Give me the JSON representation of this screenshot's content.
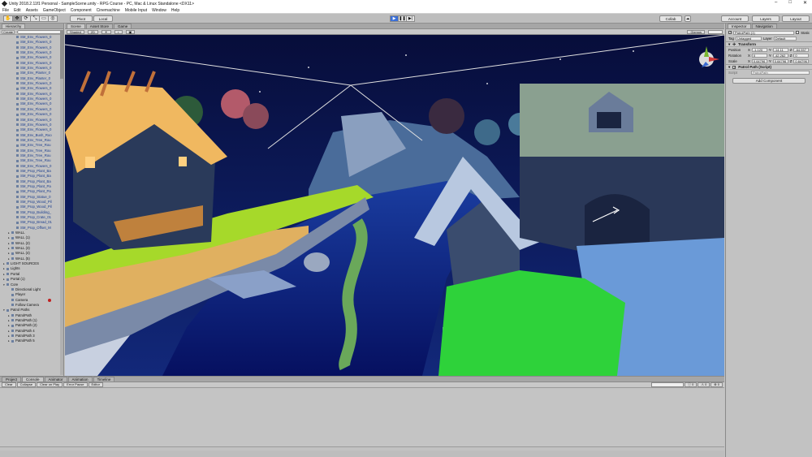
{
  "window": {
    "title": "Unity 2018.2.11f1 Personal - SampleScene.unity - RPG Course - PC, Mac & Linux Standalone <DX11>"
  },
  "menu": [
    "File",
    "Edit",
    "Assets",
    "GameObject",
    "Component",
    "Cinemachine",
    "Mobile Input",
    "Window",
    "Help"
  ],
  "toolbar": {
    "pivot": "Pivot",
    "local": "Local",
    "collab": "Collab",
    "account": "Account",
    "layers": "Layers",
    "layout": "Layout"
  },
  "hierarchy": {
    "tab": "Hierarchy",
    "create": "Create",
    "rows": [
      {
        "label": "SM_Env_Flowers_0",
        "indent": 2,
        "prefab": true
      },
      {
        "label": "SM_Env_Flowers_0",
        "indent": 2,
        "prefab": true
      },
      {
        "label": "SM_Env_Flowers_0",
        "indent": 2,
        "prefab": true
      },
      {
        "label": "SM_Env_Flowers_0",
        "indent": 2,
        "prefab": true
      },
      {
        "label": "SM_Env_Flowers_0",
        "indent": 2,
        "prefab": true
      },
      {
        "label": "SM_Env_Flowers_0",
        "indent": 2,
        "prefab": true
      },
      {
        "label": "SM_Env_Flowers_0",
        "indent": 2,
        "prefab": true
      },
      {
        "label": "SM_Env_Planter_0",
        "indent": 2,
        "prefab": true
      },
      {
        "label": "SM_Env_Planter_0",
        "indent": 2,
        "prefab": true
      },
      {
        "label": "SM_Env_Flowers_0",
        "indent": 2,
        "prefab": true
      },
      {
        "label": "SM_Env_Flowers_0",
        "indent": 2,
        "prefab": true
      },
      {
        "label": "SM_Env_Flowers_0",
        "indent": 2,
        "prefab": true
      },
      {
        "label": "SM_Env_Flowers_0",
        "indent": 2,
        "prefab": true
      },
      {
        "label": "SM_Env_Flowers_0",
        "indent": 2,
        "prefab": true
      },
      {
        "label": "SM_Env_Flowers_0",
        "indent": 2,
        "prefab": true
      },
      {
        "label": "SM_Env_Flowers_0",
        "indent": 2,
        "prefab": true
      },
      {
        "label": "SM_Env_Flowers_0",
        "indent": 2,
        "prefab": true
      },
      {
        "label": "SM_Env_Flowers_0",
        "indent": 2,
        "prefab": true
      },
      {
        "label": "SM_Env_Flowers_0",
        "indent": 2,
        "prefab": true
      },
      {
        "label": "SM_Env_Bush_Roo",
        "indent": 2,
        "prefab": true
      },
      {
        "label": "SM_Env_Tree_Rou",
        "indent": 2,
        "prefab": true
      },
      {
        "label": "SM_Env_Tree_Rou",
        "indent": 2,
        "prefab": true
      },
      {
        "label": "SM_Env_Tree_Rou",
        "indent": 2,
        "prefab": true
      },
      {
        "label": "SM_Env_Tree_Rou",
        "indent": 2,
        "prefab": true
      },
      {
        "label": "SM_Env_Tree_Rou",
        "indent": 2,
        "prefab": true
      },
      {
        "label": "SM_Env_Flowers_0",
        "indent": 2,
        "prefab": true
      },
      {
        "label": "SM_Prop_Plant_Ba",
        "indent": 2,
        "prefab": true
      },
      {
        "label": "SM_Prop_Plant_Ba",
        "indent": 2,
        "prefab": true
      },
      {
        "label": "SM_Prop_Plant_Ba",
        "indent": 2,
        "prefab": true
      },
      {
        "label": "SM_Prop_Plant_Pa",
        "indent": 2,
        "prefab": true
      },
      {
        "label": "SM_Prop_Plant_Pa",
        "indent": 2,
        "prefab": true
      },
      {
        "label": "SM_Prop_Statue_0",
        "indent": 2,
        "prefab": true
      },
      {
        "label": "SM_Prop_Wood_Pil",
        "indent": 2,
        "prefab": true
      },
      {
        "label": "SM_Prop_Wood_Pil",
        "indent": 2,
        "prefab": true
      },
      {
        "label": "SM_Prop_Building_",
        "indent": 2,
        "prefab": true
      },
      {
        "label": "SM_Prop_Crate_01",
        "indent": 2,
        "prefab": true
      },
      {
        "label": "SM_Prop_Bread_01",
        "indent": 2,
        "prefab": true
      },
      {
        "label": "SM_Prop_Offset_M",
        "indent": 2,
        "prefab": true
      },
      {
        "label": "WALL",
        "indent": 1,
        "prefab": false,
        "expand": "▸"
      },
      {
        "label": "WALL (1)",
        "indent": 1,
        "prefab": false,
        "expand": "▸"
      },
      {
        "label": "WALL (2)",
        "indent": 1,
        "prefab": false,
        "expand": "▸"
      },
      {
        "label": "WALL (3)",
        "indent": 1,
        "prefab": false,
        "expand": "▸"
      },
      {
        "label": "WALL (4)",
        "indent": 1,
        "prefab": false,
        "expand": "▸"
      },
      {
        "label": "WALL (5)",
        "indent": 1,
        "prefab": false,
        "expand": "▸"
      },
      {
        "label": "LIGHT SOURCES",
        "indent": 0,
        "prefab": false,
        "expand": "▸"
      },
      {
        "label": "Lights",
        "indent": 0,
        "prefab": false,
        "expand": "▸"
      },
      {
        "label": "Portal",
        "indent": 0,
        "prefab": false,
        "expand": "▸"
      },
      {
        "label": "Portal (1)",
        "indent": 0,
        "prefab": false,
        "expand": "▸"
      },
      {
        "label": "Core",
        "indent": 0,
        "prefab": false,
        "expand": "▾"
      },
      {
        "label": "Directional Light",
        "indent": 1,
        "prefab": false
      },
      {
        "label": "Player",
        "indent": 1,
        "prefab": false
      },
      {
        "label": "Camera",
        "indent": 1,
        "prefab": false,
        "dot": true
      },
      {
        "label": "Follow Camera",
        "indent": 1,
        "prefab": false
      },
      {
        "label": "Patrol Paths",
        "indent": 0,
        "prefab": false,
        "expand": "▾"
      },
      {
        "label": "PatrolPath",
        "indent": 1,
        "prefab": false,
        "expand": "▸"
      },
      {
        "label": "PatrolPath (1)",
        "indent": 1,
        "prefab": false,
        "expand": "▸"
      },
      {
        "label": "PatrolPath (2)",
        "indent": 1,
        "prefab": false,
        "expand": "▸"
      },
      {
        "label": "PatrolPath 4",
        "indent": 1,
        "prefab": false,
        "expand": "▸"
      },
      {
        "label": "PatrolPath 3",
        "indent": 1,
        "prefab": false,
        "expand": "▸"
      },
      {
        "label": "PatrolPath 5",
        "indent": 1,
        "prefab": false,
        "expand": "▸"
      }
    ]
  },
  "scene": {
    "tabs": [
      "Scene",
      "Asset Store",
      "Game"
    ],
    "shading": "Shaded",
    "mode": "2D",
    "gizmos": "Gizmos"
  },
  "inspector": {
    "tabs": [
      "Inspector",
      "Navigation"
    ],
    "object_name": "PatrolPath (1)",
    "static": "Static",
    "tag_label": "Tag",
    "tag": "Untagged",
    "layer_label": "Layer",
    "layer": "Default",
    "transform": {
      "title": "Transform",
      "rows": [
        {
          "label": "Position",
          "x": "-1.120",
          "y": "-14.11",
          "z": "-64.557"
        },
        {
          "label": "Rotation",
          "x": "0",
          "y": "-42.262",
          "z": "0"
        },
        {
          "label": "Scale",
          "x": "0.64796",
          "y": "0.64796",
          "z": "0.64796"
        }
      ]
    },
    "script": {
      "title": "Patrol Path (Script)",
      "label": "Script",
      "value": "PatrolPath"
    },
    "add_component": "Add Component"
  },
  "console": {
    "tabs": [
      "Project",
      "Console",
      "Animator",
      "Animation",
      "Timeline"
    ],
    "buttons": [
      "Clear",
      "Collapse",
      "Clear on Play",
      "Error Pause",
      "Editor"
    ],
    "counts": [
      "0",
      "0",
      "0"
    ]
  }
}
